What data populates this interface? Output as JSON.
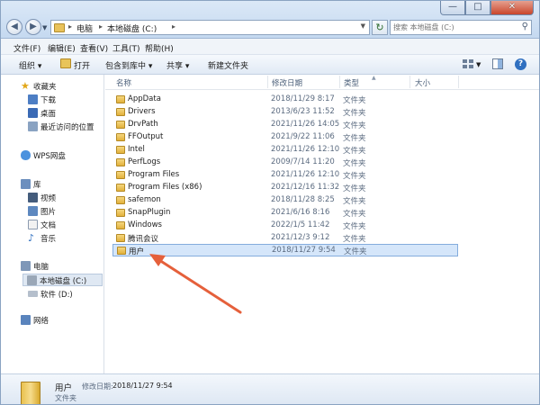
{
  "address": {
    "crumbs": [
      "电脑",
      "本地磁盘 (C:)"
    ]
  },
  "search": {
    "placeholder": "搜索 本地磁盘 (C:)"
  },
  "menu": [
    "文件(F)",
    "编辑(E)",
    "查看(V)",
    "工具(T)",
    "帮助(H)"
  ],
  "toolbar": {
    "organize": "组织 ▾",
    "open": "打开",
    "include": "包含到库中 ▾",
    "share": "共享 ▾",
    "new_folder": "新建文件夹"
  },
  "nav": {
    "favorites": "收藏夹",
    "downloads": "下载",
    "desktop": "桌面",
    "recent": "最近访问的位置",
    "wps": "WPS网盘",
    "libraries": "库",
    "videos": "视频",
    "pictures": "图片",
    "documents": "文档",
    "music": "音乐",
    "computer": "电脑",
    "local_c": "本地磁盘 (C:)",
    "soft_d": "软件 (D:)",
    "network": "网络"
  },
  "columns": {
    "name": "名称",
    "date": "修改日期",
    "type": "类型",
    "size": "大小"
  },
  "files": [
    {
      "name": "AppData",
      "date": "2018/11/29 8:17",
      "type": "文件夹"
    },
    {
      "name": "Drivers",
      "date": "2013/6/23 11:52",
      "type": "文件夹"
    },
    {
      "name": "DrvPath",
      "date": "2021/11/26 14:05",
      "type": "文件夹"
    },
    {
      "name": "FFOutput",
      "date": "2021/9/22 11:06",
      "type": "文件夹"
    },
    {
      "name": "Intel",
      "date": "2021/11/26 12:10",
      "type": "文件夹"
    },
    {
      "name": "PerfLogs",
      "date": "2009/7/14 11:20",
      "type": "文件夹"
    },
    {
      "name": "Program Files",
      "date": "2021/11/26 12:10",
      "type": "文件夹"
    },
    {
      "name": "Program Files (x86)",
      "date": "2021/12/16 11:32",
      "type": "文件夹"
    },
    {
      "name": "safemon",
      "date": "2018/11/28 8:25",
      "type": "文件夹"
    },
    {
      "name": "SnapPlugin",
      "date": "2021/6/16 8:16",
      "type": "文件夹"
    },
    {
      "name": "Windows",
      "date": "2022/1/5 11:42",
      "type": "文件夹"
    },
    {
      "name": "腾讯会议",
      "date": "2021/12/3 9:12",
      "type": "文件夹"
    },
    {
      "name": "用户",
      "date": "2018/11/27 9:54",
      "type": "文件夹",
      "selected": true
    }
  ],
  "details": {
    "name": "用户",
    "date_label": "修改日期:",
    "date_value": "2018/11/27 9:54",
    "type": "文件夹"
  },
  "colors": {
    "accent": "#2f6fc0",
    "selection": "#d5e6fa",
    "arrow": "#e5603b"
  },
  "icons": [
    "back-icon",
    "forward-icon",
    "folder-icon",
    "refresh-icon",
    "search-icon",
    "help-icon",
    "star-icon",
    "network-icon"
  ]
}
